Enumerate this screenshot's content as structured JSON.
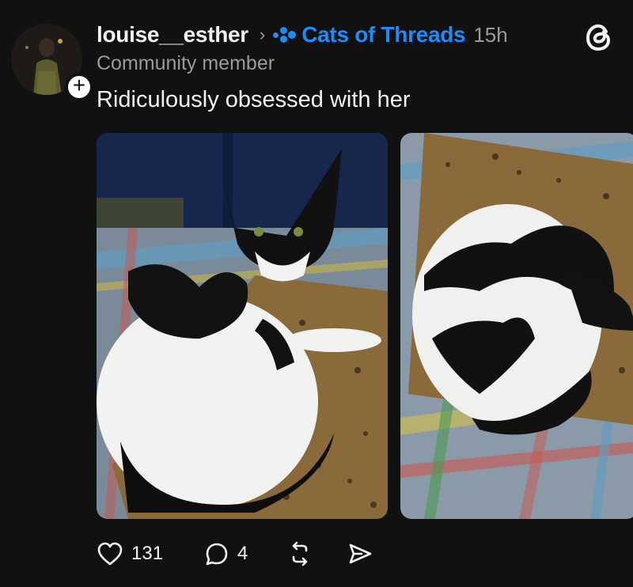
{
  "post": {
    "author": "louise__esther",
    "community": "Cats of Threads",
    "time": "15h",
    "role": "Community member",
    "text": "Ridiculously obsessed with her"
  },
  "actions": {
    "likes": "131",
    "replies": "4"
  },
  "colors": {
    "background": "#111111",
    "community_accent": "#1d8cf8",
    "secondary_text": "#9a9a9a"
  }
}
